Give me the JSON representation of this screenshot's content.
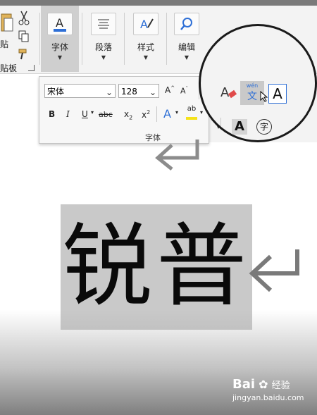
{
  "ribbon": {
    "clipboard": {
      "paste_label": "贴",
      "group_label": "贴板"
    },
    "font_button": {
      "label": "字体"
    },
    "paragraph_button": {
      "label": "段落"
    },
    "styles_button": {
      "label": "样式"
    },
    "editing_button": {
      "label": "编辑"
    }
  },
  "font_panel": {
    "font_name": "宋体",
    "font_size": "128",
    "grow_font": "A",
    "shrink_font": "A",
    "bold": "B",
    "italic": "I",
    "underline": "U",
    "strikethrough": "abc",
    "subscript": "x",
    "subscript_mark": "2",
    "superscript": "x",
    "superscript_mark": "2",
    "text_effects": "A",
    "highlight": "ab",
    "group_label": "字体"
  },
  "magnifier": {
    "clear_format": "A",
    "phonetic_top": "wén",
    "phonetic_char": "文",
    "char_border": "A",
    "char_shading": "A",
    "enclose_char": "字"
  },
  "document": {
    "selected_text": "锐普"
  },
  "watermark": {
    "brand": "Bai",
    "brand_cn": "经验",
    "url": "jingyan.baidu.com"
  },
  "colors": {
    "accent_blue": "#2e6fd6",
    "highlight_yellow": "#f5e21a",
    "eraser_red": "#e04a4a",
    "selection_gray": "#c9c9c9"
  }
}
